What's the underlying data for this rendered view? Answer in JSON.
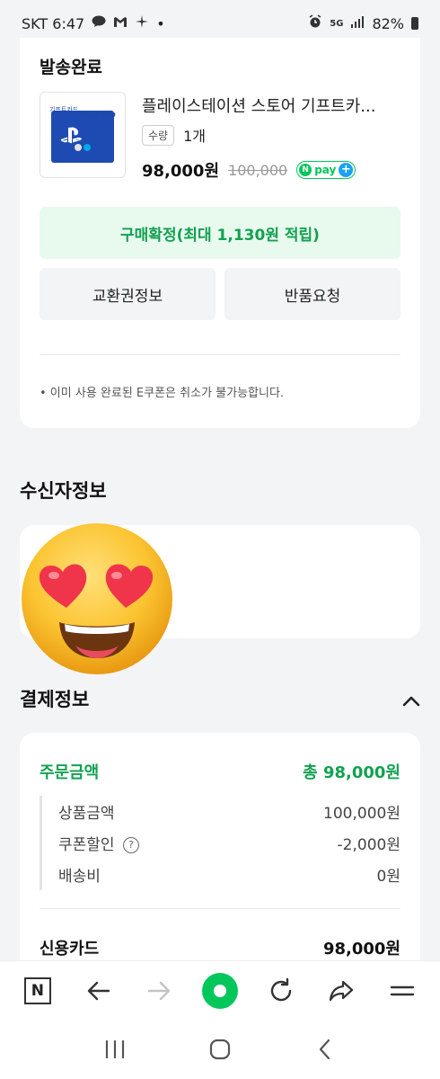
{
  "status_bar": {
    "carrier_time": "SKT 6:47",
    "dot": "•",
    "battery": "82%",
    "network": "5G"
  },
  "shipping": {
    "title": "발송완료",
    "product_name": "플레이스테이션 스토어 기프트카...",
    "thumb_price": "₩100,000",
    "thumb_caption": "기프트카드",
    "qty_label": "수량",
    "qty_value": "1개",
    "price": "98,000원",
    "original_price": "100,000",
    "npay_label": "pay",
    "confirm_button": "구매확정(최대 1,130원 적립)",
    "exchange_info_button": "교환권정보",
    "return_button": "반품요청",
    "notice": "• 이미 사용 완료된 E쿠폰은 취소가 불가능합니다."
  },
  "recipient": {
    "title": "수신자정보"
  },
  "payment": {
    "title": "결제정보",
    "order_amount_label": "주문금액",
    "order_amount_value": "총 98,000원",
    "rows": [
      {
        "label": "상품금액",
        "value": "100,000원"
      },
      {
        "label": "쿠폰할인",
        "value": "-2,000원"
      },
      {
        "label": "배송비",
        "value": "0원"
      }
    ],
    "card_label": "신용카드",
    "card_value": "98,000원"
  },
  "browser": {
    "n_label": "N"
  },
  "colors": {
    "brand_green": "#03c75a",
    "confirm_text": "#12a150",
    "confirm_bg": "#e8f9ee",
    "background": "#f3f4f6"
  }
}
